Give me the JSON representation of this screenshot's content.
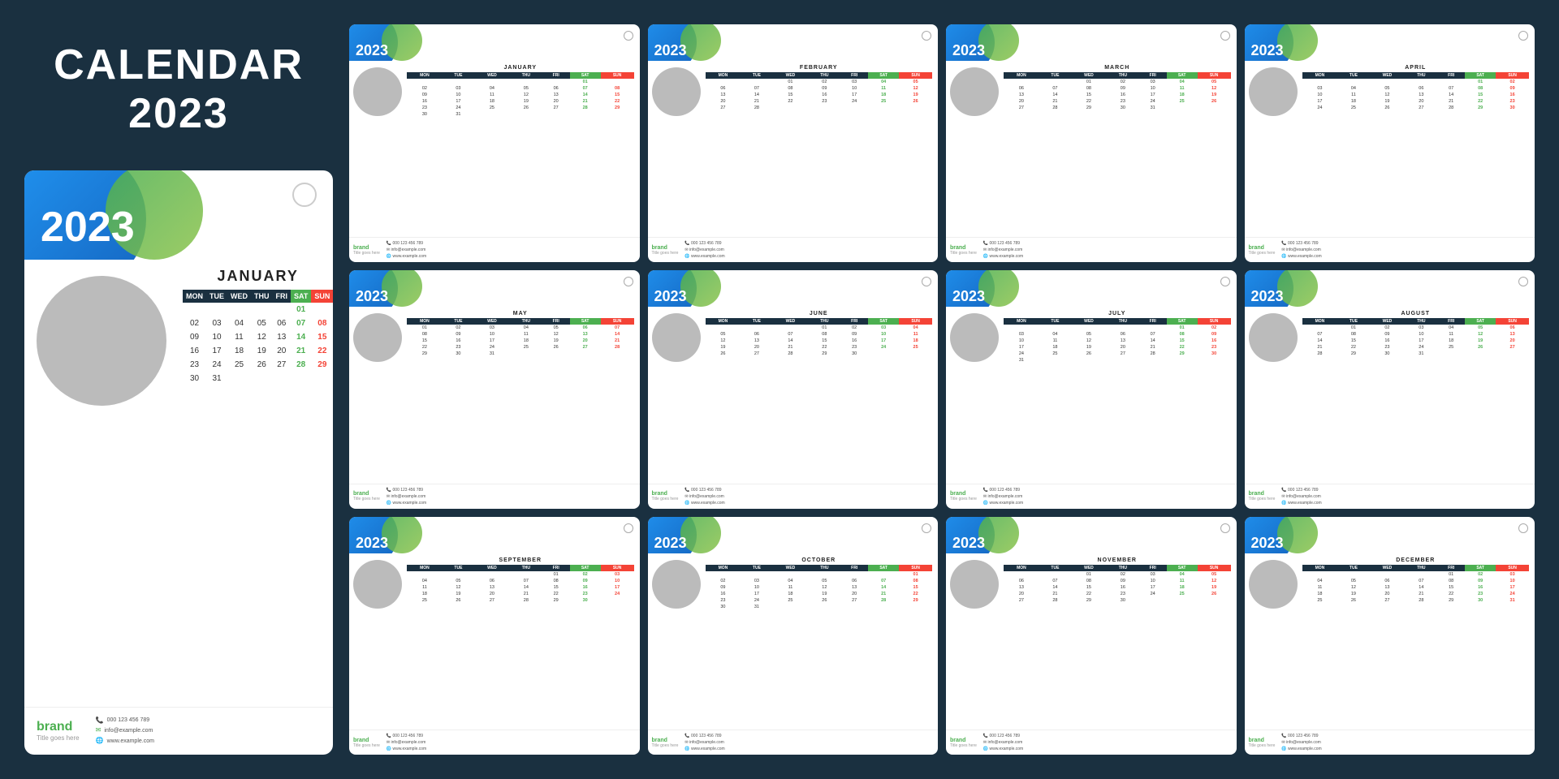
{
  "page": {
    "background": "#1a3040",
    "title": "CALENDAR 2023"
  },
  "brand": {
    "name": "brand",
    "subtitle": "Title goes here",
    "phone": "000 123 456 789",
    "email": "info@example.com",
    "website": "www.example.com"
  },
  "large_calendar": {
    "year": "2023",
    "month": "JANUARY",
    "days_header": [
      "MON",
      "TUE",
      "WED",
      "THU",
      "FRI",
      "SAT",
      "SUN"
    ],
    "weeks": [
      [
        "",
        "",
        "",
        "",
        "",
        "01",
        ""
      ],
      [
        "02",
        "03",
        "04",
        "05",
        "06",
        "07",
        "08"
      ],
      [
        "09",
        "10",
        "11",
        "12",
        "13",
        "14",
        "15"
      ],
      [
        "16",
        "17",
        "18",
        "19",
        "20",
        "21",
        "22"
      ],
      [
        "23",
        "24",
        "25",
        "26",
        "27",
        "28",
        "29"
      ],
      [
        "30",
        "31",
        "",
        "",
        "",
        "",
        ""
      ]
    ]
  },
  "small_calendars": [
    {
      "year": "2023",
      "month": "JANUARY",
      "weeks": [
        [
          "",
          "",
          "",
          "",
          "",
          "01",
          ""
        ],
        [
          "02",
          "03",
          "04",
          "05",
          "06",
          "07",
          "08"
        ],
        [
          "09",
          "10",
          "11",
          "12",
          "13",
          "14",
          "15"
        ],
        [
          "16",
          "17",
          "18",
          "19",
          "20",
          "21",
          "22"
        ],
        [
          "23",
          "24",
          "25",
          "26",
          "27",
          "28",
          "29"
        ],
        [
          "30",
          "31",
          "",
          "",
          "",
          "",
          ""
        ]
      ]
    },
    {
      "year": "2023",
      "month": "FEBRUARY",
      "weeks": [
        [
          "",
          "",
          "01",
          "02",
          "03",
          "04",
          "05"
        ],
        [
          "06",
          "07",
          "08",
          "09",
          "10",
          "11",
          "12"
        ],
        [
          "13",
          "14",
          "15",
          "16",
          "17",
          "18",
          "19"
        ],
        [
          "20",
          "21",
          "22",
          "23",
          "24",
          "25",
          "26"
        ],
        [
          "27",
          "28",
          "",
          "",
          "",
          "",
          ""
        ]
      ]
    },
    {
      "year": "2023",
      "month": "MARCH",
      "weeks": [
        [
          "",
          "",
          "01",
          "02",
          "03",
          "04",
          "05"
        ],
        [
          "06",
          "07",
          "08",
          "09",
          "10",
          "11",
          "12"
        ],
        [
          "13",
          "14",
          "15",
          "16",
          "17",
          "18",
          "19"
        ],
        [
          "20",
          "21",
          "22",
          "23",
          "24",
          "25",
          "26"
        ],
        [
          "27",
          "28",
          "29",
          "30",
          "31",
          "",
          ""
        ]
      ]
    },
    {
      "year": "2023",
      "month": "APRIL",
      "weeks": [
        [
          "",
          "",
          "",
          "",
          "",
          "01",
          "02"
        ],
        [
          "03",
          "04",
          "05",
          "06",
          "07",
          "08",
          "09"
        ],
        [
          "10",
          "11",
          "12",
          "13",
          "14",
          "15",
          "16"
        ],
        [
          "17",
          "18",
          "19",
          "20",
          "21",
          "22",
          "23"
        ],
        [
          "24",
          "25",
          "26",
          "27",
          "28",
          "29",
          "30"
        ]
      ]
    },
    {
      "year": "2023",
      "month": "MAY",
      "weeks": [
        [
          "01",
          "02",
          "03",
          "04",
          "05",
          "06",
          "07"
        ],
        [
          "08",
          "09",
          "10",
          "11",
          "12",
          "13",
          "14"
        ],
        [
          "15",
          "16",
          "17",
          "18",
          "19",
          "20",
          "21"
        ],
        [
          "22",
          "23",
          "24",
          "25",
          "26",
          "27",
          "28"
        ],
        [
          "29",
          "30",
          "31",
          "",
          "",
          "",
          ""
        ]
      ]
    },
    {
      "year": "2023",
      "month": "JUNE",
      "weeks": [
        [
          "",
          "",
          "",
          "01",
          "02",
          "03",
          "04"
        ],
        [
          "05",
          "06",
          "07",
          "08",
          "09",
          "10",
          "11"
        ],
        [
          "12",
          "13",
          "14",
          "15",
          "16",
          "17",
          "18"
        ],
        [
          "19",
          "20",
          "21",
          "22",
          "23",
          "24",
          "25"
        ],
        [
          "26",
          "27",
          "28",
          "29",
          "30",
          "",
          ""
        ]
      ]
    },
    {
      "year": "2023",
      "month": "JULY",
      "weeks": [
        [
          "",
          "",
          "",
          "",
          "",
          "01",
          "02"
        ],
        [
          "03",
          "04",
          "05",
          "06",
          "07",
          "08",
          "09"
        ],
        [
          "10",
          "11",
          "12",
          "13",
          "14",
          "15",
          "16"
        ],
        [
          "17",
          "18",
          "19",
          "20",
          "21",
          "22",
          "23"
        ],
        [
          "24",
          "25",
          "26",
          "27",
          "28",
          "29",
          "30"
        ],
        [
          "31",
          "",
          "",
          "",
          "",
          "",
          ""
        ]
      ]
    },
    {
      "year": "2023",
      "month": "AUGUST",
      "weeks": [
        [
          "",
          "01",
          "02",
          "03",
          "04",
          "05",
          "06"
        ],
        [
          "07",
          "08",
          "09",
          "10",
          "11",
          "12",
          "13"
        ],
        [
          "14",
          "15",
          "16",
          "17",
          "18",
          "19",
          "20"
        ],
        [
          "21",
          "22",
          "23",
          "24",
          "25",
          "26",
          "27"
        ],
        [
          "28",
          "29",
          "30",
          "31",
          "",
          "",
          ""
        ]
      ]
    },
    {
      "year": "2023",
      "month": "SEPTEMBER",
      "weeks": [
        [
          "",
          "",
          "",
          "",
          "01",
          "02",
          "03"
        ],
        [
          "04",
          "05",
          "06",
          "07",
          "08",
          "09",
          "10"
        ],
        [
          "11",
          "12",
          "13",
          "14",
          "15",
          "16",
          "17"
        ],
        [
          "18",
          "19",
          "20",
          "21",
          "22",
          "23",
          "24"
        ],
        [
          "25",
          "26",
          "27",
          "28",
          "29",
          "30",
          ""
        ]
      ]
    },
    {
      "year": "2023",
      "month": "OCTOBER",
      "weeks": [
        [
          "",
          "",
          "",
          "",
          "",
          "",
          "01"
        ],
        [
          "02",
          "03",
          "04",
          "05",
          "06",
          "07",
          "08"
        ],
        [
          "09",
          "10",
          "11",
          "12",
          "13",
          "14",
          "15"
        ],
        [
          "16",
          "17",
          "18",
          "19",
          "20",
          "21",
          "22"
        ],
        [
          "23",
          "24",
          "25",
          "26",
          "27",
          "28",
          "29"
        ],
        [
          "30",
          "31",
          "",
          "",
          "",
          "",
          ""
        ]
      ]
    },
    {
      "year": "2023",
      "month": "NOVEMBER",
      "weeks": [
        [
          "",
          "",
          "01",
          "02",
          "03",
          "04",
          "05"
        ],
        [
          "06",
          "07",
          "08",
          "09",
          "10",
          "11",
          "12"
        ],
        [
          "13",
          "14",
          "15",
          "16",
          "17",
          "18",
          "19"
        ],
        [
          "20",
          "21",
          "22",
          "23",
          "24",
          "25",
          "26"
        ],
        [
          "27",
          "28",
          "29",
          "30",
          "",
          "",
          ""
        ]
      ]
    },
    {
      "year": "2023",
      "month": "DECEMBER",
      "weeks": [
        [
          "",
          "",
          "",
          "",
          "01",
          "02",
          "03"
        ],
        [
          "04",
          "05",
          "06",
          "07",
          "08",
          "09",
          "10"
        ],
        [
          "11",
          "12",
          "13",
          "14",
          "15",
          "16",
          "17"
        ],
        [
          "18",
          "19",
          "20",
          "21",
          "22",
          "23",
          "24"
        ],
        [
          "25",
          "26",
          "27",
          "28",
          "29",
          "30",
          "31"
        ]
      ]
    }
  ],
  "days_header": [
    "MON",
    "TUE",
    "WED",
    "THU",
    "FRI",
    "SAT",
    "SUN"
  ]
}
